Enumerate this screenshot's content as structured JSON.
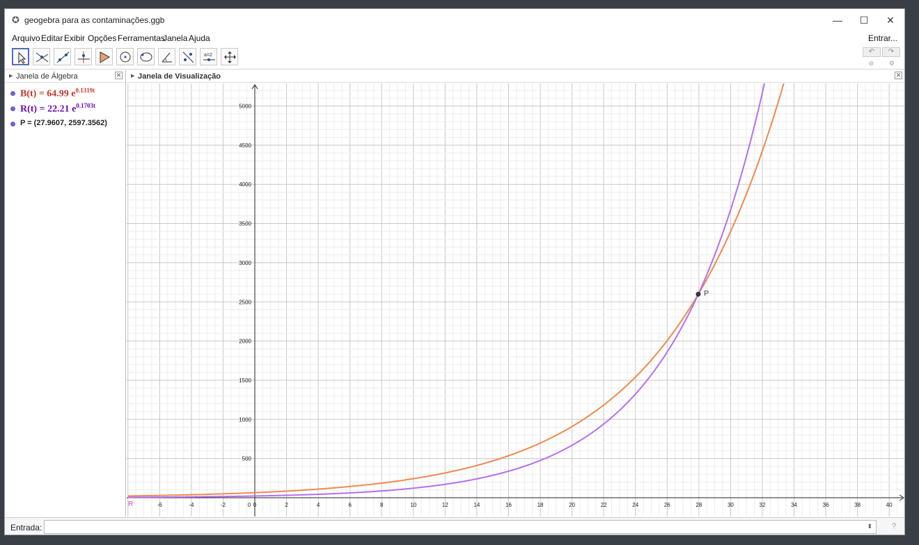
{
  "window": {
    "title": "geogebra para as contaminações.ggb",
    "minimize": "—",
    "maximize": "☐",
    "close": "✕"
  },
  "menu": {
    "items": [
      "Arquivo",
      "Editar",
      "Exibir",
      "Opções",
      "Ferramentas",
      "Janela",
      "Ajuda"
    ],
    "entrar": "Entrar..."
  },
  "toolbar": {
    "tools": [
      "move",
      "point",
      "line",
      "perpendicular-line",
      "polygon",
      "circle",
      "conic",
      "angle",
      "reflect",
      "slider",
      "move-view"
    ],
    "slider_label": "a=2",
    "undo": "↶",
    "redo": "↷",
    "help": "⊘",
    "settings": "⚙"
  },
  "algebra": {
    "title": "Janela de Álgebra",
    "close": "✕",
    "B": {
      "text": "B(t) = 64.99 e",
      "exp": "0.1319t",
      "color": "#c0392b"
    },
    "R": {
      "text": "R(t) = 22.21 e",
      "exp": "0.1703t",
      "color": "#6a0dad"
    },
    "P": "P = (27.9607, 2597.3562)"
  },
  "graphics": {
    "title": "Janela de Visualização",
    "close": "✕",
    "point_label": "P",
    "r_label": "R"
  },
  "input": {
    "label": "Entrada:",
    "value": "",
    "arrow": "⬍",
    "help": "?"
  },
  "chart_data": {
    "type": "line",
    "xlim": [
      -8,
      40
    ],
    "ylim": [
      0,
      5200
    ],
    "x_ticks": [
      -6,
      -4,
      -2,
      0,
      2,
      4,
      6,
      8,
      10,
      12,
      14,
      16,
      18,
      20,
      22,
      24,
      26,
      28,
      30,
      32,
      34,
      36,
      38,
      40
    ],
    "y_ticks": [
      500,
      1000,
      1500,
      2000,
      2500,
      3000,
      3500,
      4000,
      4500,
      5000
    ],
    "grid": true,
    "series": [
      {
        "name": "B",
        "a": 64.99,
        "k": 0.1319,
        "color": "#f0884e"
      },
      {
        "name": "R",
        "a": 22.21,
        "k": 0.1703,
        "color": "#b46ff0"
      }
    ],
    "point": {
      "name": "P",
      "x": 27.9607,
      "y": 2597.3562
    }
  },
  "colors": {
    "axis": "#222222",
    "grid_major": "#c8c8c8",
    "grid_minor": "#ececec"
  }
}
